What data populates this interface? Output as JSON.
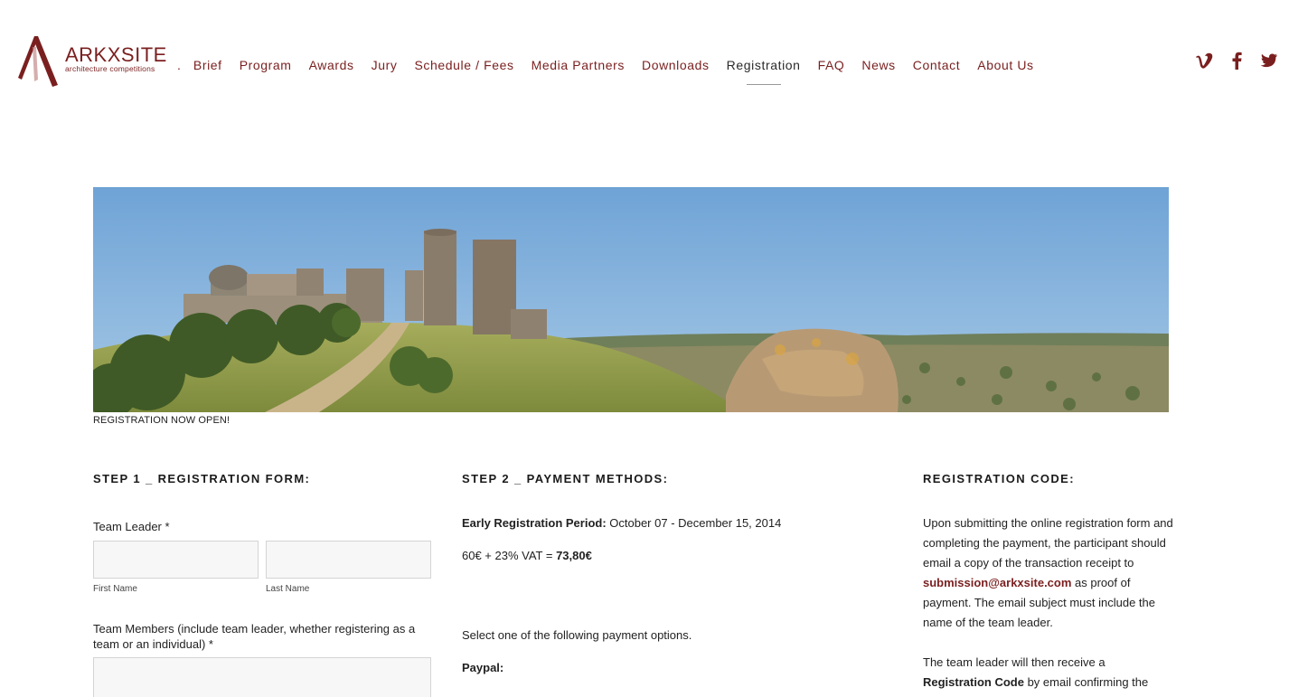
{
  "brand": {
    "wordmark": "ARKXSITE",
    "tagline": "architecture competitions",
    "color": "#7a1f1f"
  },
  "nav": {
    "separator": ".",
    "items": [
      {
        "label": "Brief"
      },
      {
        "label": "Program"
      },
      {
        "label": "Awards"
      },
      {
        "label": "Jury"
      },
      {
        "label": "Schedule / Fees"
      },
      {
        "label": "Media Partners"
      },
      {
        "label": "Downloads"
      },
      {
        "label": "Registration",
        "active": true
      },
      {
        "label": "FAQ"
      },
      {
        "label": "News"
      },
      {
        "label": "Contact"
      },
      {
        "label": "About Us"
      }
    ]
  },
  "social": [
    "vimeo-icon",
    "facebook-icon",
    "twitter-icon"
  ],
  "banner": {
    "caption": "REGISTRATION NOW OPEN!"
  },
  "step1": {
    "title": "STEP 1 _ REGISTRATION FORM:",
    "team_leader_label": "Team Leader",
    "required_mark": "*",
    "first_name_label": "First Name",
    "last_name_label": "Last Name",
    "first_name_value": "",
    "last_name_value": "",
    "members_label": "Team Members (include team leader, whether registering as a team or an individual)",
    "members_value": ""
  },
  "step2": {
    "title": "STEP 2 _ PAYMENT METHODS:",
    "early_label": "Early Registration Period:",
    "early_dates": " October 07 - December 15, 2014",
    "price_text": "60€ + 23% VAT = ",
    "price_total": "73,80€",
    "select_text": "Select one of the following payment options.",
    "paypal_label": "Paypal:"
  },
  "regcode": {
    "title": "REGISTRATION CODE:",
    "p1_before": "Upon submitting the online registration form and completing the payment, the participant should email a copy of the transaction receipt to ",
    "email": "submission@arkxsite.com",
    "p1_after": " as proof of payment. The email subject must include the name of the team leader.",
    "p2_before": "The team leader will then receive a ",
    "p2_bold": "Registration Code",
    "p2_after": " by email confirming the"
  }
}
